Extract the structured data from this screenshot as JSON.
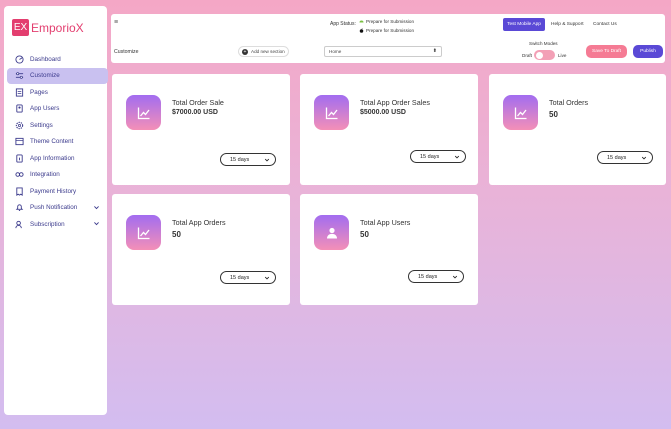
{
  "logo": {
    "badge": "EX",
    "name": "EmporioX"
  },
  "sidebar": {
    "items": [
      {
        "label": "Dashboard",
        "icon": "dashboard-icon",
        "active": false
      },
      {
        "label": "Customize",
        "icon": "sliders-icon",
        "active": true
      },
      {
        "label": "Pages",
        "icon": "pages-icon",
        "active": false
      },
      {
        "label": "App Users",
        "icon": "users-icon",
        "active": false
      },
      {
        "label": "Settings",
        "icon": "gear-icon",
        "active": false
      },
      {
        "label": "Theme Content",
        "icon": "theme-icon",
        "active": false
      },
      {
        "label": "App Information",
        "icon": "info-icon",
        "active": false
      },
      {
        "label": "Integration",
        "icon": "integration-icon",
        "active": false
      },
      {
        "label": "Payment History",
        "icon": "receipt-icon",
        "active": false
      },
      {
        "label": "Push Notification",
        "icon": "bell-icon",
        "active": false
      },
      {
        "label": "Subscription",
        "icon": "subscription-icon",
        "active": false
      }
    ]
  },
  "header": {
    "menu_icon": "≡",
    "app_status_label": "App Status:",
    "status_android": "Prepare for Submission",
    "status_ios": "Prepare for Submission",
    "test_button": "Test Mobile App",
    "help_link": "Help & Support",
    "contact_link": "Contact Us"
  },
  "toolbar": {
    "customize_label": "Customize",
    "add_section": "Add new section",
    "page_select_value": "Home",
    "switch_modes_label": "Switch Modes",
    "draft_label": "Draft",
    "live_label": "Live",
    "save_draft": "Save To Draft",
    "publish": "Publish"
  },
  "cards": [
    {
      "title": "Total Order Sale",
      "value": "$7000.00 USD",
      "period": "15 days",
      "icon": "trend-chart-icon"
    },
    {
      "title": "Total App Order Sales",
      "value": "$5000.00 USD",
      "period": "15 days",
      "icon": "trend-chart-icon"
    },
    {
      "title": "Total Orders",
      "value": "50",
      "period": "15 days",
      "icon": "trend-chart-icon"
    },
    {
      "title": "Total App Orders",
      "value": "50",
      "period": "15 days",
      "icon": "trend-chart-icon"
    },
    {
      "title": "Total App Users",
      "value": "50",
      "period": "15 days",
      "icon": "user-icon"
    }
  ],
  "colors": {
    "brand": "#e33e6f",
    "primary": "#5a49d6",
    "draft": "#f57b94",
    "active_nav": "#c9c1f0"
  }
}
